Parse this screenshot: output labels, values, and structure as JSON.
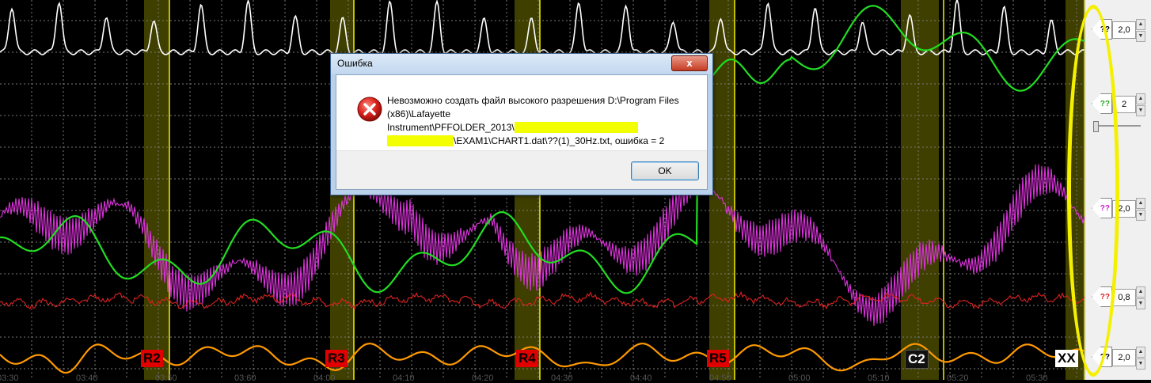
{
  "dialog": {
    "title": "Ошибка",
    "close_glyph": "x",
    "message_part1": "Невозможно создать файл высокого разрешения D:\\Program Files (x86)\\Lafayette Instrument\\PFFOLDER_2013\\",
    "message_redacted1": "xxxxxxxxxxxxxxxxxxxxxxxxxx",
    "message_redacted2": "xxxxxxxxxxxxxx",
    "message_part2": "\\EXAM1\\CHART1.dat\\??(1)_30Hz.txt, ошибка = 2",
    "ok_label": "OK",
    "icon": "error-icon"
  },
  "markers": [
    {
      "label": "R2",
      "style": "red"
    },
    {
      "label": "R3",
      "style": "red"
    },
    {
      "label": "R4",
      "style": "red"
    },
    {
      "label": "R5",
      "style": "red"
    },
    {
      "label": "C2",
      "style": "dark"
    },
    {
      "label": "XX",
      "style": "white"
    }
  ],
  "time_labels": [
    "03:30",
    "03:40",
    "03:50",
    "03:60",
    "04:00",
    "04:10",
    "04:20",
    "04:30",
    "04:40",
    "04:50",
    "05:00",
    "05:10",
    "05:20",
    "05:30"
  ],
  "channels": [
    {
      "name": "pneumo-upper",
      "color": "#ffffff",
      "arrow_text": "??",
      "value": "2,0"
    },
    {
      "name": "cardio",
      "color": "#22dd22",
      "arrow_text": "??",
      "value": "2"
    },
    {
      "name": "eda",
      "color": "#dd33dd",
      "arrow_text": "??",
      "value": "2,0"
    },
    {
      "name": "movement",
      "color": "#dd2222",
      "arrow_text": "??",
      "value": "0,8"
    },
    {
      "name": "pneumo-lower",
      "color": "#ff9900",
      "arrow_text": "??",
      "value": "2,0"
    }
  ],
  "colors": {
    "highlight": "#f5f000",
    "band": "#4a4a00",
    "grid": "#7a7a7a"
  }
}
